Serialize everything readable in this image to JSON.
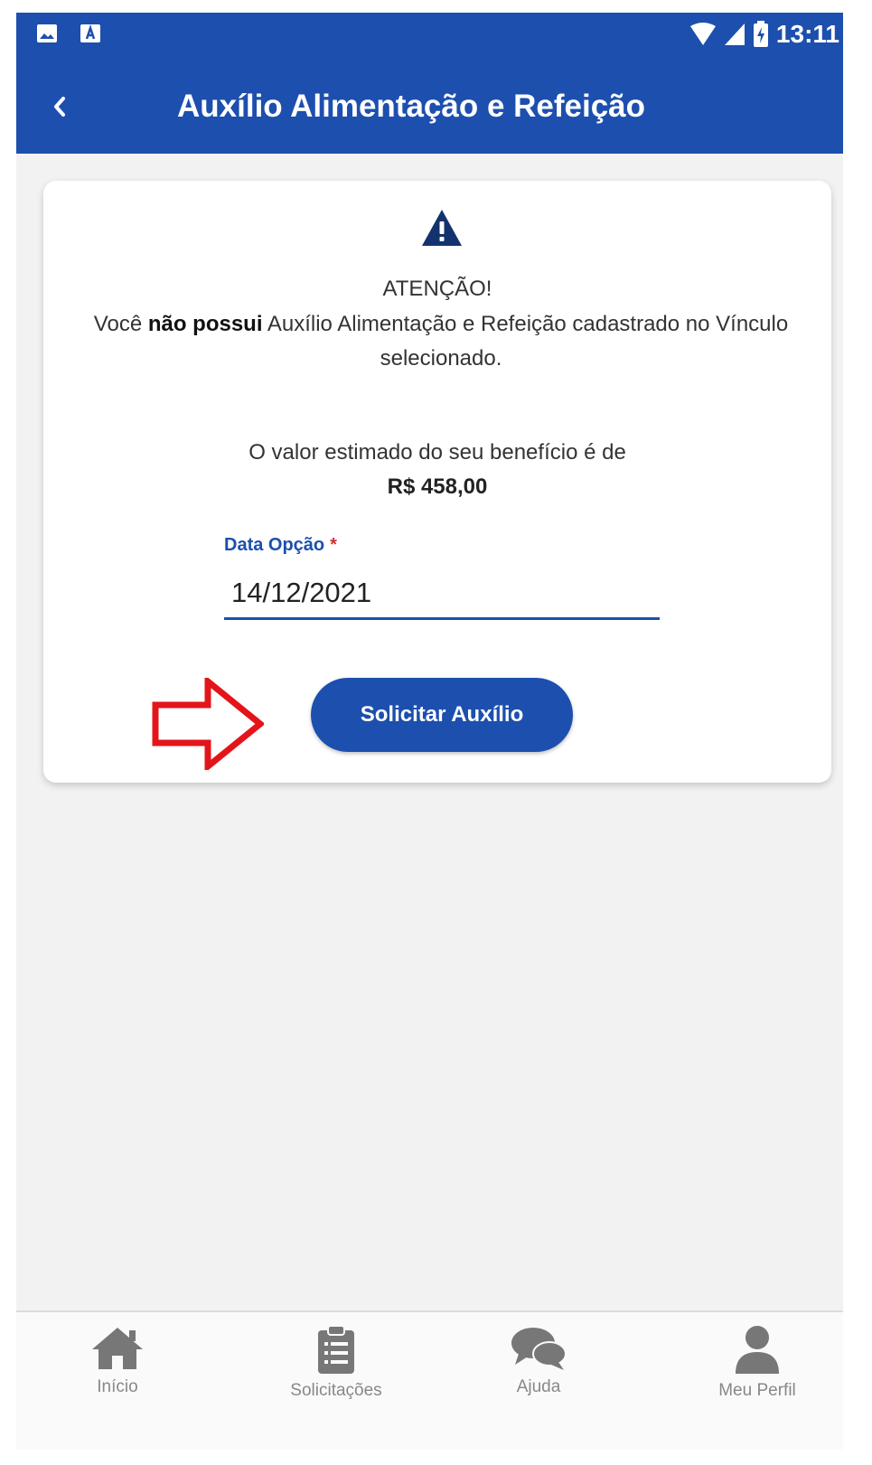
{
  "status_bar": {
    "time": "13:11"
  },
  "app_bar": {
    "title": "Auxílio Alimentação e Refeição"
  },
  "notice": {
    "heading": "ATENÇÃO!",
    "message_before": "Você ",
    "message_bold": "não possui",
    "message_after": " Auxílio Alimentação e Refeição cadastrado no Vínculo selecionado."
  },
  "estimate": {
    "text": "O valor estimado do seu benefício é de",
    "amount": "R$ 458,00"
  },
  "date_field": {
    "label": "Data Opção",
    "required_mark": "*",
    "value": "14/12/2021"
  },
  "submit_button": {
    "label": "Solicitar Auxílio"
  },
  "bottom_nav": [
    {
      "label": "Início",
      "icon": "home-icon"
    },
    {
      "label": "Solicitações",
      "icon": "clipboard-icon"
    },
    {
      "label": "Ajuda",
      "icon": "chat-bubbles-icon"
    },
    {
      "label": "Meu Perfil",
      "icon": "user-icon"
    }
  ],
  "colors": {
    "primary": "#1c4fae",
    "background": "#f2f2f2",
    "annotation_arrow": "#e3151a",
    "required": "#d32f2f"
  }
}
